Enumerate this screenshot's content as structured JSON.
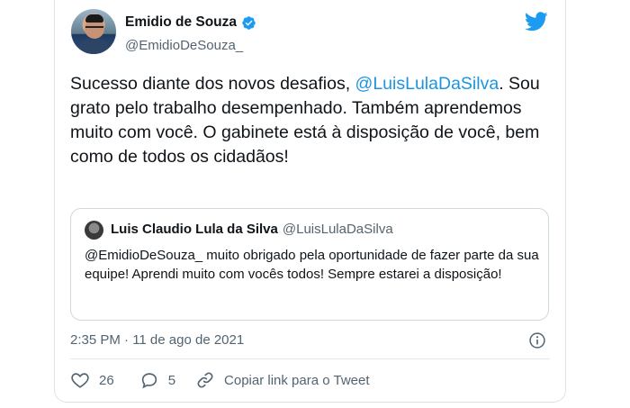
{
  "author": {
    "name": "Emidio de Souza",
    "handle": "@EmidioDeSouza_"
  },
  "tweet": {
    "text_part1": "Sucesso diante dos novos desafios, ",
    "mention": "@LuisLulaDaSilva",
    "text_part2": ". Sou grato pelo trabalho desempenhado. Também aprendemos muito com você. O gabinete está à disposição de você, bem como de todos os cidadãos!",
    "timestamp": "2:35 PM · 11 de ago de 2021"
  },
  "quote": {
    "name": "Luis Claudio Lula da Silva",
    "handle": "@LuisLulaDaSilva",
    "text": "@EmidioDeSouza_ muito obrigado pela oportunidade de fazer parte da sua equipe! Aprendi muito com vocês todos! Sempre estarei a disposição!"
  },
  "actions": {
    "likes": "26",
    "replies": "5",
    "copy_link": "Copiar link para o Tweet"
  },
  "colors": {
    "accent": "#1d9bf0",
    "mention": "#1b95e0",
    "muted_text": "#536471"
  },
  "icons": {
    "verified": "verified-badge-icon",
    "logo": "twitter-bird-icon",
    "info": "info-icon",
    "like": "heart-icon",
    "reply": "reply-bubble-icon",
    "share": "link-icon"
  }
}
